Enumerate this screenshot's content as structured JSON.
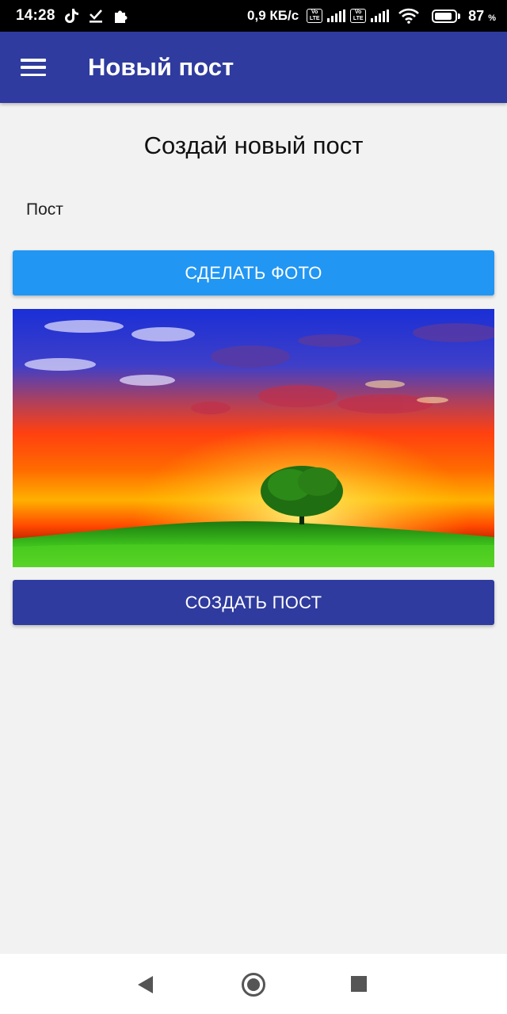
{
  "status_bar": {
    "time": "14:28",
    "left_icons": [
      "tiktok-icon",
      "download-done-icon",
      "puzzle-icon"
    ],
    "net_speed": "0,9 КБ/с",
    "volte_top": "Vo",
    "volte_bottom": "LTE",
    "battery_percent": "87",
    "battery_unit": "%",
    "battery_level": 0.87
  },
  "app_bar": {
    "title": "Новый пост",
    "menu_icon": "hamburger-menu-icon"
  },
  "main": {
    "heading": "Создай новый пост",
    "post_placeholder": "Пост",
    "take_photo_label": "СДЕЛАТЬ ФОТО",
    "create_post_label": "СОЗДАТЬ ПОСТ"
  },
  "nav_bar": {
    "icons": [
      "back-icon",
      "home-icon",
      "recent-apps-icon"
    ]
  },
  "colors": {
    "primary": "#2f3b9e",
    "accent": "#2196f3",
    "background": "#f2f2f2"
  }
}
